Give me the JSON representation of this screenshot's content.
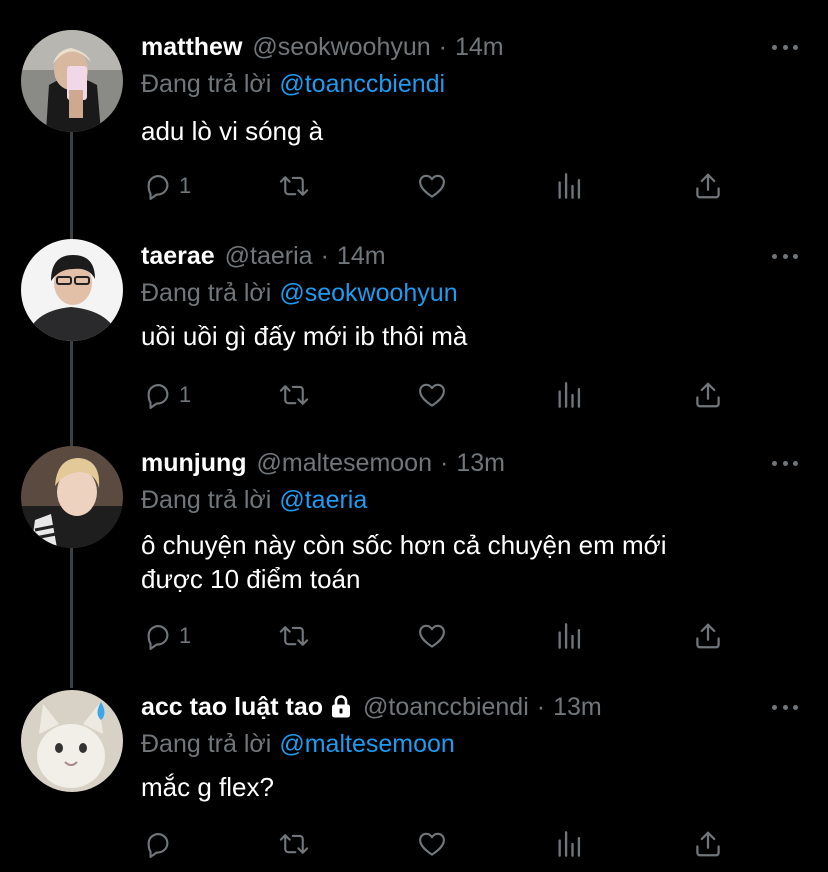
{
  "thread": {
    "tweets": [
      {
        "name": "matthew",
        "handle": "@seokwoohyun",
        "separator": "·",
        "time": "14m",
        "reply_prefix": "Đang trả lời",
        "reply_to": "@toanccbiendi",
        "text": "adu lò vi sóng à",
        "reply_count": "1"
      },
      {
        "name": "taerae",
        "handle": "@taeria",
        "separator": "·",
        "time": "14m",
        "reply_prefix": "Đang trả lời",
        "reply_to": "@seokwoohyun",
        "text": "uồi uồi gì đấy mới ib thôi mà",
        "reply_count": "1"
      },
      {
        "name": "munjung",
        "handle": "@maltesemoon",
        "separator": "·",
        "time": "13m",
        "reply_prefix": "Đang trả lời",
        "reply_to": "@taeria",
        "text_line1": "ô chuyện này còn sốc hơn cả chuyện em mới",
        "text_line2": "được 10 điểm toán",
        "reply_count": "1"
      },
      {
        "name": "acc tao luật tao",
        "handle": "@toanccbiendi",
        "separator": "·",
        "time": "13m",
        "reply_prefix": "Đang trả lời",
        "reply_to": "@maltesemoon",
        "text": "mắc g flex?",
        "reply_count": ""
      }
    ]
  },
  "icons": {
    "reply": "reply-bubble-icon",
    "retweet": "retweet-icon",
    "like": "heart-icon",
    "analytics": "analytics-bars-icon",
    "share": "share-upload-icon",
    "more": "more-dots-icon",
    "lock": "lock-icon"
  },
  "colors": {
    "background": "#000000",
    "name": "#ffffff",
    "muted": "#71767b",
    "link": "#1d9bf0",
    "thread_line": "#3c4043"
  }
}
